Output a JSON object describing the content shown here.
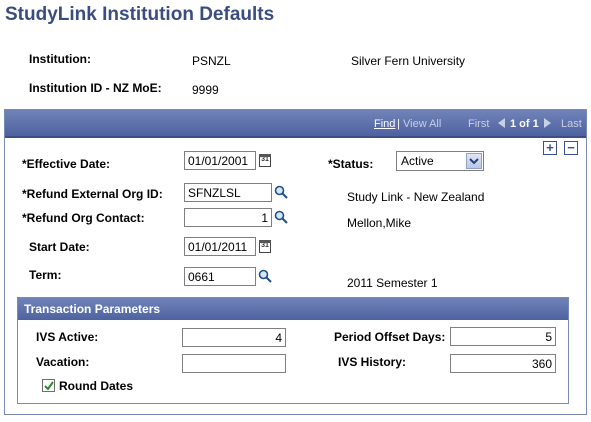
{
  "page": {
    "title": "StudyLink Institution Defaults"
  },
  "header": {
    "institution_label": "Institution:",
    "institution_code": "PSNZL",
    "institution_name": "Silver Fern University",
    "institution_id_label": "Institution ID - NZ MoE:",
    "institution_id": "9999"
  },
  "nav": {
    "find": "Find",
    "sep": "|",
    "view_all": "View All",
    "first": "First",
    "count": "1 of 1",
    "last": "Last"
  },
  "form": {
    "effective_date_label": "*Effective Date:",
    "effective_date": "01/01/2001",
    "status_label": "*Status:",
    "status": "Active",
    "refund_org_id_label": "*Refund External Org ID:",
    "refund_org_id": "SFNZLSL",
    "refund_org_desc": "Study Link - New Zealand",
    "refund_contact_label": "*Refund Org Contact:",
    "refund_contact": "1",
    "refund_contact_name": "Mellon,Mike",
    "start_date_label": "Start Date:",
    "start_date": "01/01/2011",
    "term_label": "Term:",
    "term": "0661",
    "term_desc": "2011 Semester 1",
    "add_row": "+",
    "delete_row": "−"
  },
  "transaction": {
    "title": "Transaction Parameters",
    "ivs_active_label": "IVS Active:",
    "ivs_active": "4",
    "vacation_label": "Vacation:",
    "vacation": "",
    "period_offset_label": "Period Offset Days:",
    "period_offset": "5",
    "ivs_history_label": "IVS History:",
    "ivs_history": "360",
    "round_dates_label": "Round Dates",
    "round_dates_checked": true
  },
  "icons": {
    "calendar": "calendar-icon",
    "lookup": "magnifier-icon",
    "dropdown": "chevron-down-icon"
  }
}
